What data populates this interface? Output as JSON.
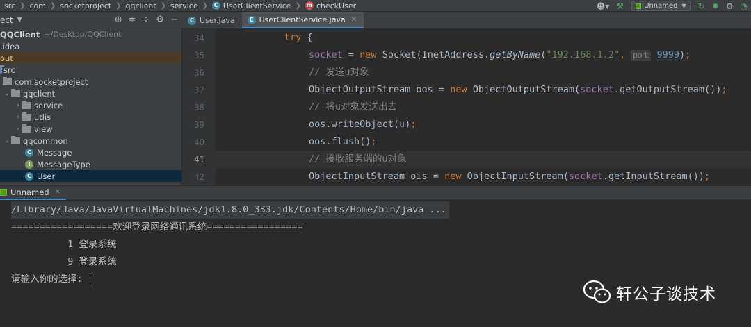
{
  "breadcrumb": {
    "items": [
      "src",
      "com",
      "socketproject",
      "qqclient",
      "service",
      "UserClientService",
      "checkUser"
    ]
  },
  "toolbar": {
    "run_config": "Unnamed"
  },
  "project_panel": {
    "title": "ect",
    "tree": [
      {
        "label": "QQClient",
        "extra": "~/Desktop/QQClient",
        "kind": "module",
        "expanded": true
      },
      {
        "label": ".idea",
        "kind": "folder",
        "expanded": false
      },
      {
        "label": "out",
        "kind": "folder",
        "expanded": false
      },
      {
        "label": "src",
        "kind": "folder",
        "expanded": true
      },
      {
        "label": "com.socketproject",
        "kind": "package",
        "expanded": true
      },
      {
        "label": "qqclient",
        "kind": "package",
        "expanded": true
      },
      {
        "label": "service",
        "kind": "package",
        "expanded": false
      },
      {
        "label": "utlis",
        "kind": "package",
        "expanded": false
      },
      {
        "label": "view",
        "kind": "package",
        "expanded": false
      },
      {
        "label": "qqcommon",
        "kind": "package",
        "expanded": true
      },
      {
        "label": "Message",
        "kind": "class"
      },
      {
        "label": "MessageType",
        "kind": "enum"
      },
      {
        "label": "User",
        "kind": "class",
        "selected": true
      }
    ]
  },
  "editor": {
    "tabs": [
      {
        "label": "User.java",
        "active": false
      },
      {
        "label": "UserClientService.java",
        "active": true
      }
    ],
    "current_line": 41,
    "lines": [
      {
        "num": "34",
        "text": "try {"
      },
      {
        "num": "35",
        "text": "socket = new Socket(InetAddress.getByName(\"192.168.1.2\"),  port: 9999);"
      },
      {
        "num": "36",
        "text": "// 发送u对象"
      },
      {
        "num": "37",
        "text": "ObjectOutputStream oos = new ObjectOutputStream(socket.getOutputStream());"
      },
      {
        "num": "38",
        "text": "// 将u对象发送出去"
      },
      {
        "num": "39",
        "text": "oos.writeObject(u);"
      },
      {
        "num": "40",
        "text": "oos.flush();"
      },
      {
        "num": "41",
        "text": "// 接收服务端的u对象"
      },
      {
        "num": "42",
        "text": "ObjectInputStream ois = new ObjectInputStream(socket.getInputStream());"
      }
    ]
  },
  "run_panel": {
    "tab_label": "Unnamed",
    "console_lines": [
      "/Library/Java/JavaVirtualMachines/jdk1.8.0_333.jdk/Contents/Home/bin/java ...",
      "==================欢迎登录网络通讯系统=================",
      "          1 登录系统",
      "          9 登录系统",
      "请输入你的选择: "
    ]
  },
  "watermark": {
    "text": "轩公子谈技术"
  },
  "colors": {
    "keyword": "#cc7832",
    "field": "#9876aa",
    "string": "#6a8759",
    "number": "#6897bb",
    "comment": "#808080",
    "default_code": "#a9b7c6"
  }
}
